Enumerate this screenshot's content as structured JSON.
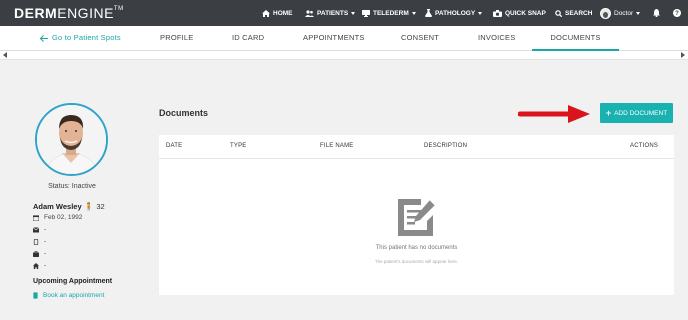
{
  "app": {
    "logo_bold": "DERM",
    "logo_light": "ENGINE",
    "trademark": "TM"
  },
  "nav": {
    "home": "HOME",
    "patients": "PATIENTS",
    "telederm": "TELEDERM",
    "pathology": "PATHOLOGY",
    "quick_snap": "QUICK SNAP",
    "search": "SEARCH",
    "user": "Doctor"
  },
  "tabs": {
    "back": "Go to Patient Spots",
    "items": [
      "PROFILE",
      "ID CARD",
      "APPOINTMENTS",
      "CONSENT",
      "INVOICES",
      "DOCUMENTS"
    ],
    "active": "DOCUMENTS"
  },
  "patient": {
    "status": "Status: Inactive",
    "name": "Adam Wesley",
    "age": "32",
    "dob": "Feb 02, 1992",
    "email": "-",
    "phone": "-",
    "work": "-",
    "address": "-",
    "upcoming_title": "Upcoming Appointment",
    "book_link": "Book an appointment"
  },
  "documents": {
    "title": "Documents",
    "add_button": "ADD DOCUMENT",
    "columns": [
      "DATE",
      "TYPE",
      "FILE NAME",
      "DESCRIPTION",
      "ACTIONS"
    ],
    "empty_message": "This patient has no documents",
    "empty_sub": "The patient's documents will appear here."
  },
  "colors": {
    "accent": "#1ab1b1",
    "topbar": "#3b3f44",
    "arrow": "#d9151b"
  },
  "icons": [
    "home-icon",
    "patients-icon",
    "telederm-icon",
    "pathology-icon",
    "camera-icon",
    "search-icon",
    "bell-icon",
    "help-icon"
  ]
}
